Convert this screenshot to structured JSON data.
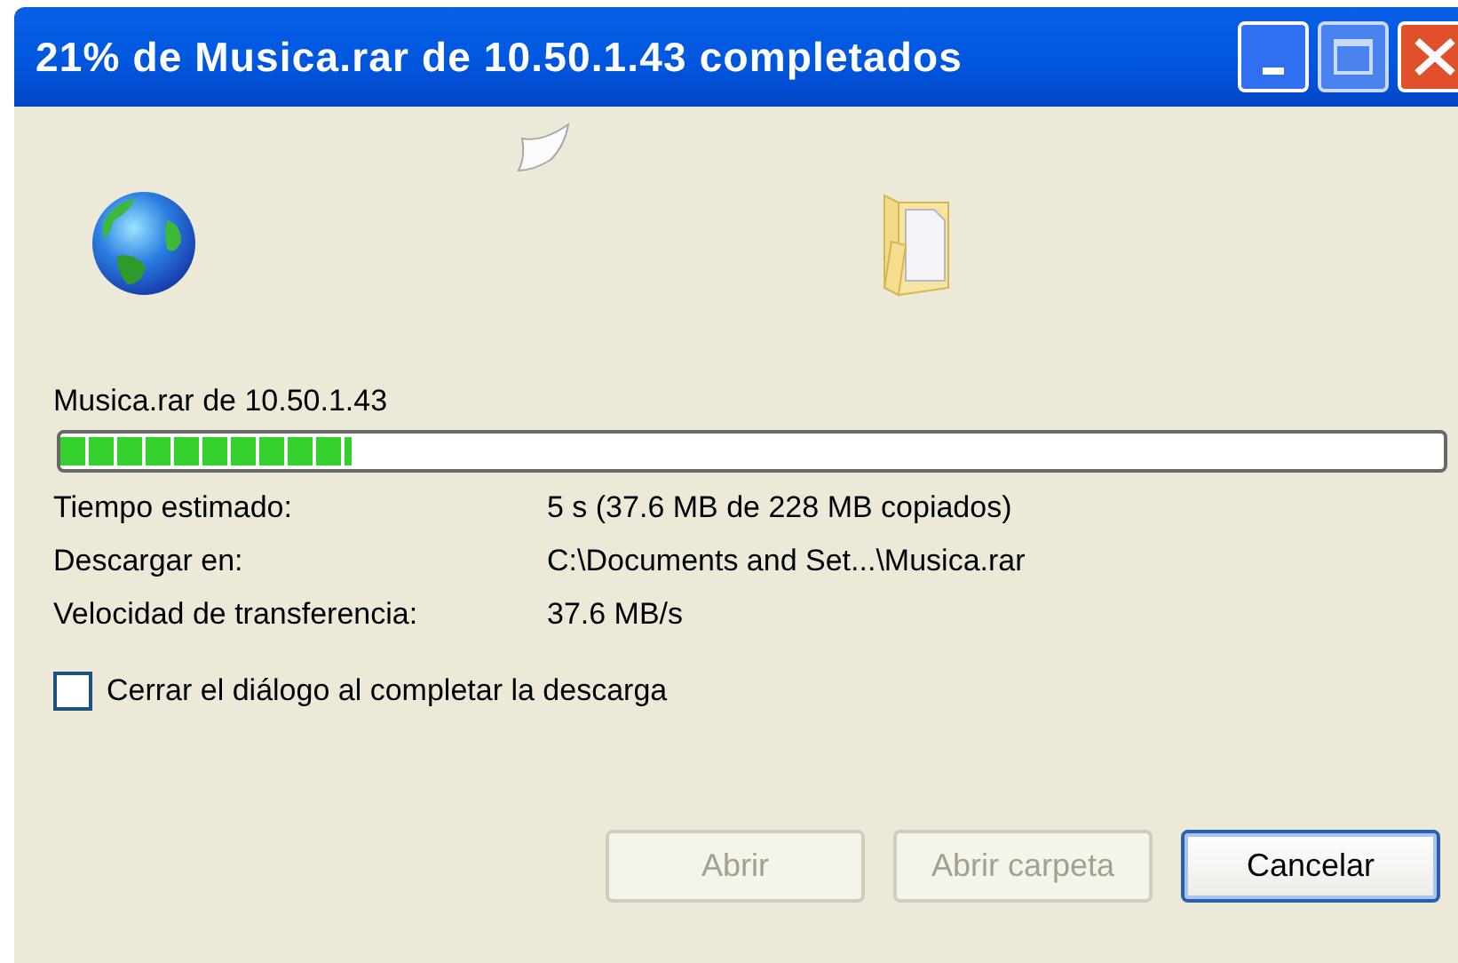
{
  "window": {
    "title": "21% de Musica.rar de 10.50.1.43 completados"
  },
  "download": {
    "source_label": "Musica.rar de 10.50.1.43",
    "progress": {
      "level": 0.21
    }
  },
  "details": [
    {
      "label": "Tiempo estimado:",
      "value": "5 s (37.6 MB de 228 MB copiados)"
    },
    {
      "label": "Descargar en:",
      "value": "C:\\Documents and Set...\\Musica.rar"
    },
    {
      "label": "Velocidad de transferencia:",
      "value": "37.6 MB/s"
    }
  ],
  "close_on_complete": {
    "label": "Cerrar el diálogo al completar la descarga",
    "checked": false
  },
  "buttons": [
    {
      "label": "Abrir",
      "disabled": true,
      "default": false
    },
    {
      "label": "Abrir carpeta",
      "disabled": true,
      "default": false
    },
    {
      "label": "Cancelar",
      "disabled": false,
      "default": true
    }
  ]
}
